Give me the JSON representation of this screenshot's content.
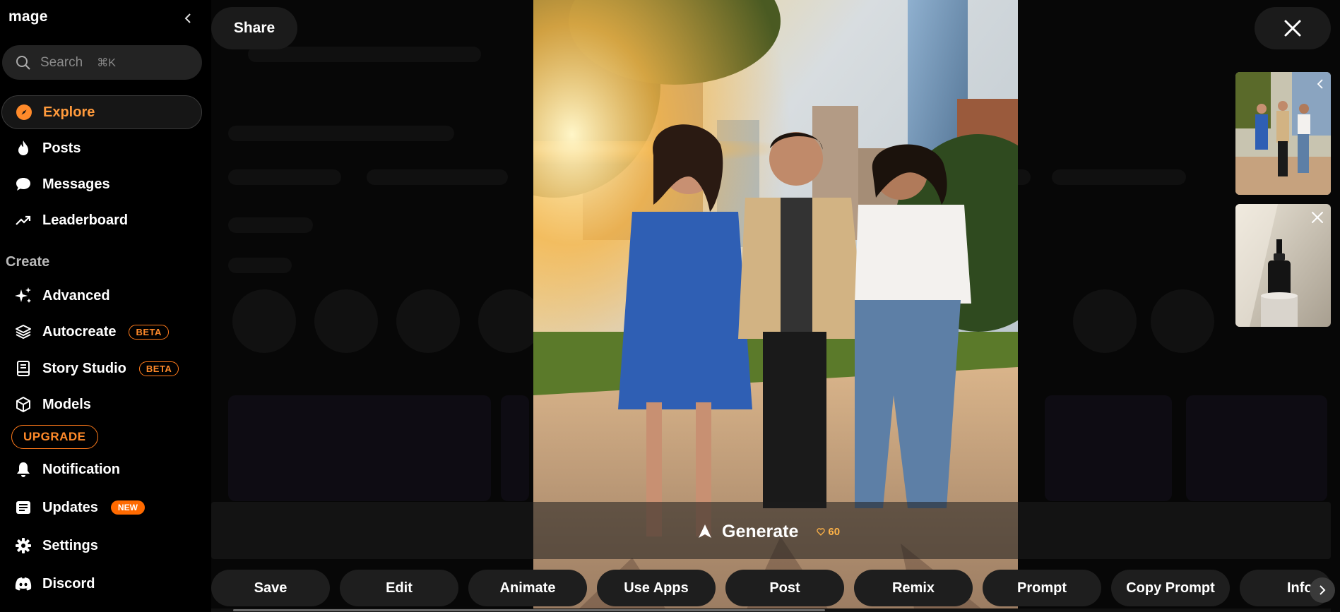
{
  "brand": "mage",
  "search": {
    "placeholder": "Search",
    "shortcut": "⌘K"
  },
  "nav": {
    "explore": "Explore",
    "posts": "Posts",
    "messages": "Messages",
    "leaderboard": "Leaderboard"
  },
  "create": {
    "title": "Create",
    "advanced": "Advanced",
    "autocreate": "Autocreate",
    "autocreate_badge": "BETA",
    "story_studio": "Story Studio",
    "story_studio_badge": "BETA",
    "models": "Models"
  },
  "upgrade": "UPGRADE",
  "bottom_nav": {
    "notification": "Notification",
    "updates": "Updates",
    "updates_badge": "NEW",
    "settings": "Settings",
    "discord": "Discord"
  },
  "viewer": {
    "share": "Share",
    "generate": "Generate",
    "generate_cost": "60"
  },
  "actions": [
    "Save",
    "Edit",
    "Animate",
    "Use Apps",
    "Post",
    "Remix",
    "Prompt",
    "Copy Prompt",
    "Info"
  ],
  "colors": {
    "accent": "#ff8a2a",
    "background": "#000000",
    "button": "#1e1e1e"
  }
}
